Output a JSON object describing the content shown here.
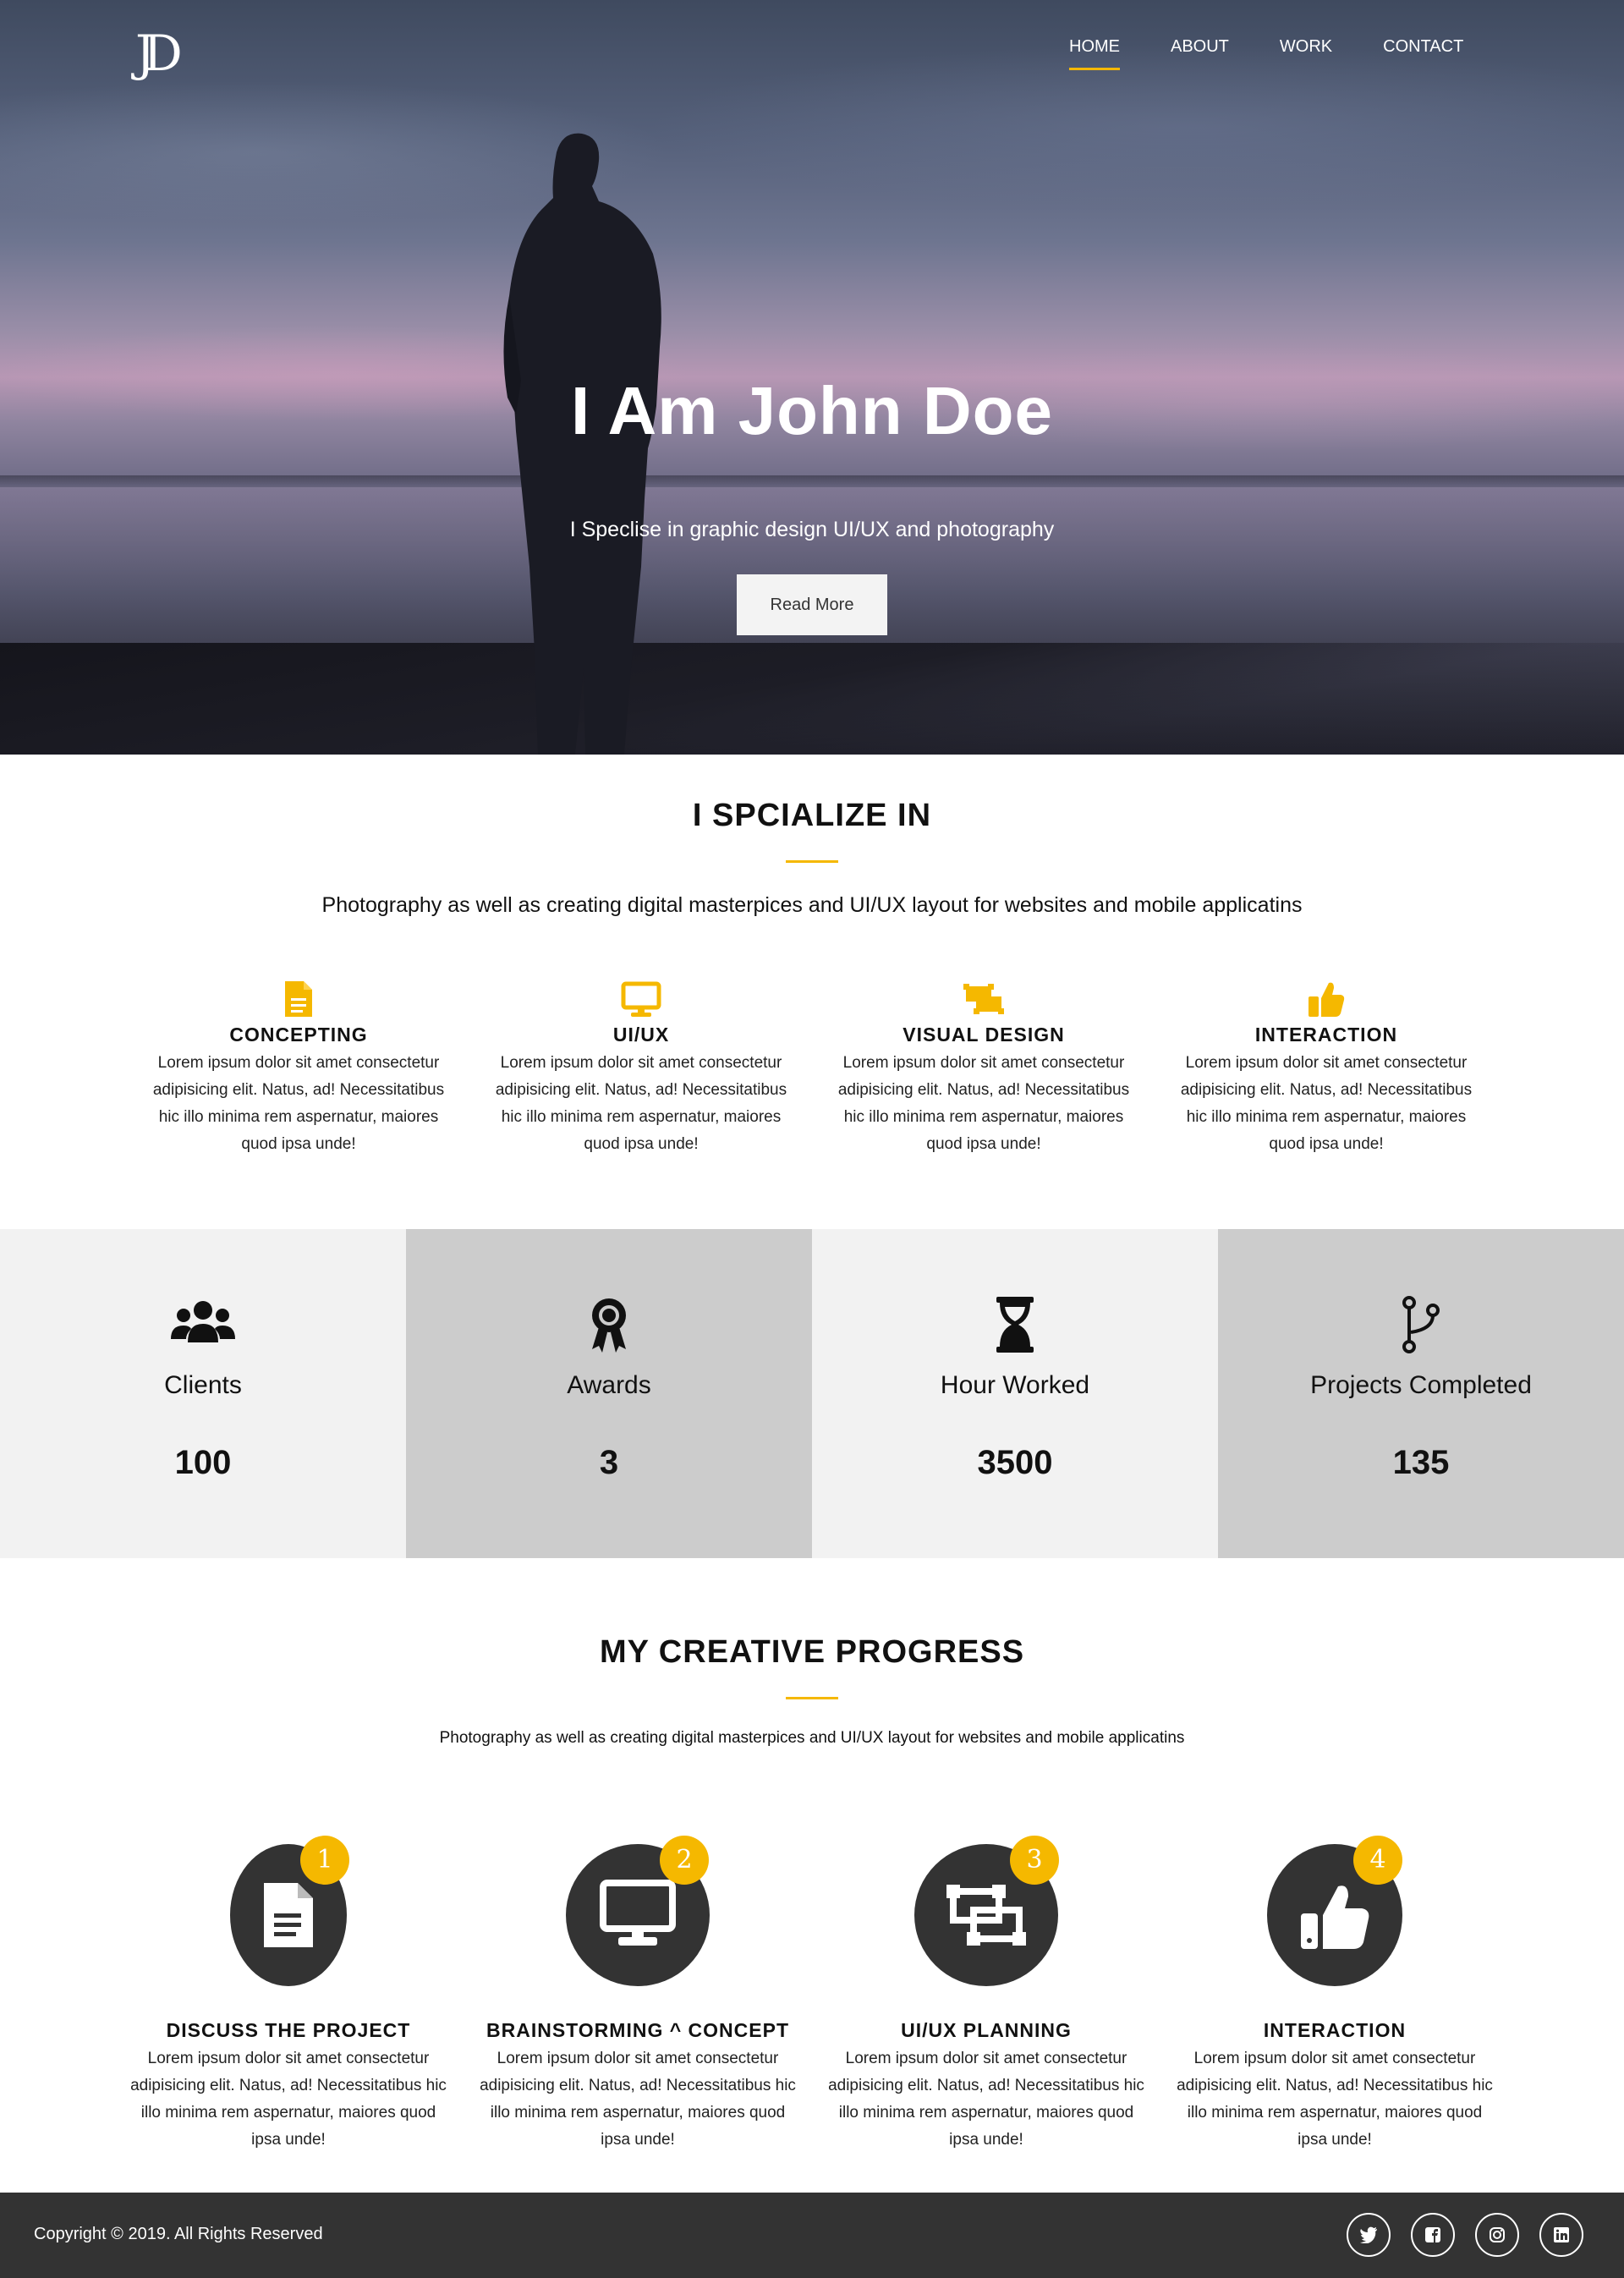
{
  "brand": {
    "logo_text": "JD"
  },
  "nav": {
    "items": [
      {
        "label": "HOME",
        "active": true
      },
      {
        "label": "ABOUT",
        "active": false
      },
      {
        "label": "WORK",
        "active": false
      },
      {
        "label": "CONTACT",
        "active": false
      }
    ]
  },
  "hero": {
    "title": "I Am John Doe",
    "subtitle": "I Speclise in graphic design UI/UX and photography",
    "button_label": "Read More"
  },
  "specialize": {
    "title": "I SPCIALIZE IN",
    "description": "Photography as well as creating digital masterpices and UI/UX layout for websites and mobile applicatins",
    "items": [
      {
        "icon": "document-icon",
        "title": "CONCEPTING",
        "text": "Lorem ipsum dolor sit amet consectetur adipisicing elit. Natus, ad! Necessitatibus hic illo minima rem aspernatur, maiores quod ipsa unde!"
      },
      {
        "icon": "desktop-icon",
        "title": "UI/UX",
        "text": "Lorem ipsum dolor sit amet consectetur adipisicing elit. Natus, ad! Necessitatibus hic illo minima rem aspernatur, maiores quod ipsa unde!"
      },
      {
        "icon": "object-ungroup-icon",
        "title": "VISUAL DESIGN",
        "text": "Lorem ipsum dolor sit amet consectetur adipisicing elit. Natus, ad! Necessitatibus hic illo minima rem aspernatur, maiores quod ipsa unde!"
      },
      {
        "icon": "thumbs-up-icon",
        "title": "INTERACTION",
        "text": "Lorem ipsum dolor sit amet consectetur adipisicing elit. Natus, ad! Necessitatibus hic illo minima rem aspernatur, maiores quod ipsa unde!"
      }
    ]
  },
  "stats": [
    {
      "icon": "users-icon",
      "label": "Clients",
      "value": "100"
    },
    {
      "icon": "award-icon",
      "label": "Awards",
      "value": "3"
    },
    {
      "icon": "hourglass-icon",
      "label": "Hour Worked",
      "value": "3500"
    },
    {
      "icon": "code-branch-icon",
      "label": "Projects Completed",
      "value": "135"
    }
  ],
  "process": {
    "title": "MY CREATIVE PROGRESS",
    "description": "Photography as well as creating digital masterpices and UI/UX layout for websites and mobile applicatins",
    "steps": [
      {
        "number": "1",
        "icon": "document-icon",
        "title": "DISCUSS THE PROJECT",
        "text": "Lorem ipsum dolor sit amet consectetur adipisicing elit. Natus, ad! Necessitatibus hic illo minima rem aspernatur, maiores quod ipsa unde!"
      },
      {
        "number": "2",
        "icon": "desktop-icon",
        "title": "BRAINSTORMING ^ CONCEPT",
        "text": "Lorem ipsum dolor sit amet consectetur adipisicing elit. Natus, ad! Necessitatibus hic illo minima rem aspernatur, maiores quod ipsa unde!"
      },
      {
        "number": "3",
        "icon": "object-ungroup-icon",
        "title": "UI/UX PLANNING",
        "text": "Lorem ipsum dolor sit amet consectetur adipisicing elit. Natus, ad! Necessitatibus hic illo minima rem aspernatur, maiores quod ipsa unde!"
      },
      {
        "number": "4",
        "icon": "thumbs-up-icon",
        "title": "INTERACTION",
        "text": "Lorem ipsum dolor sit amet consectetur adipisicing elit. Natus, ad! Necessitatibus hic illo minima rem aspernatur, maiores quod ipsa unde!"
      }
    ]
  },
  "footer": {
    "copyright": "Copyright © 2019. All Rights Reserved",
    "social": [
      "twitter-icon",
      "facebook-icon",
      "instagram-icon",
      "linkedin-icon"
    ]
  },
  "colors": {
    "accent": "#f5b800",
    "dark": "#333333",
    "stat_light": "#f2f2f2",
    "stat_dark": "#cccccc"
  }
}
